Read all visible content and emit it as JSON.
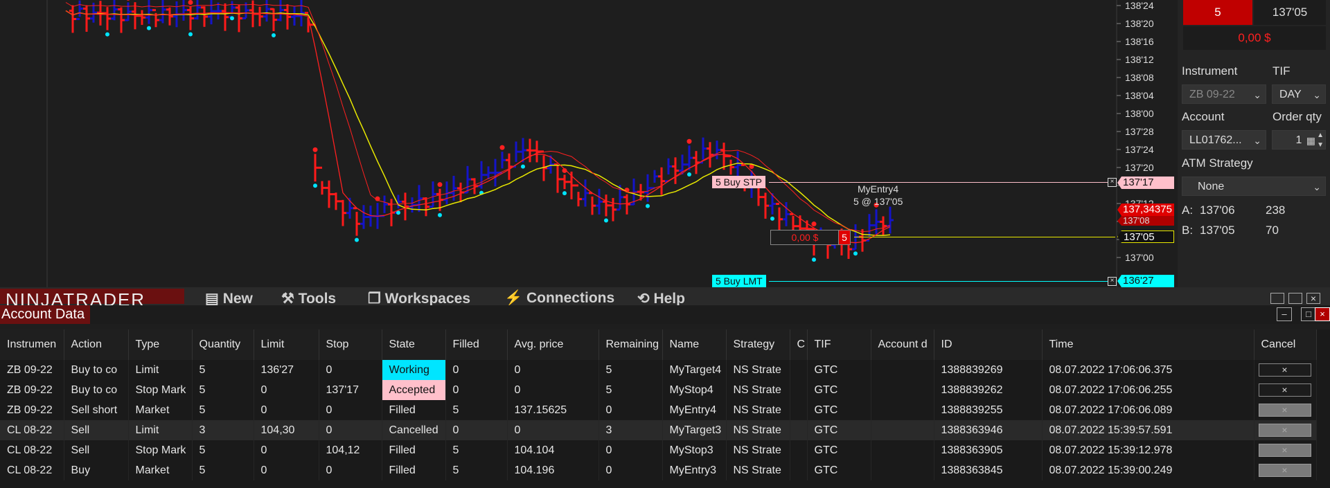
{
  "chart": {
    "price_axis": [
      "138'24",
      "138'20",
      "138'16",
      "138'12",
      "138'08",
      "138'04",
      "138'00",
      "137'28",
      "137'24",
      "137'20",
      "137'16",
      "137'12",
      "137'08",
      "137'04",
      "137'00"
    ],
    "last_price": "137,34375",
    "tags": {
      "buy_stp_price": "137'17",
      "last_price_dup": "137'08",
      "position_price": "137'05",
      "buy_lmt_price": "136'27"
    },
    "buy_stp_label": "5 Buy STP",
    "buy_lmt_label": "5 Buy LMT",
    "entry_name": "MyEntry4",
    "entry_detail": "5 @ 137'05",
    "pnl": "0,00 $",
    "position_qty": "5",
    "colors": {
      "up_bar": "#1414c8",
      "down_bar": "#ff1a1a",
      "sma_yellow": "#e8e800",
      "stop_tag": "#ffc0cb",
      "limit_tag": "#00ffff"
    }
  },
  "order_panel": {
    "qty": "5",
    "price": "137'05",
    "pnl": "0,00 $",
    "instrument_label": "Instrument",
    "tif_label": "TIF",
    "instrument_value": "ZB 09-22",
    "tif_value": "DAY",
    "account_label": "Account",
    "order_qty_label": "Order qty",
    "account_value": "LL01762...",
    "order_qty_value": "1",
    "atm_label": "ATM Strategy",
    "atm_value": "None",
    "ask_label": "A:",
    "ask_price": "137'06",
    "ask_size": "238",
    "bid_label": "B:",
    "bid_price": "137'05",
    "bid_size": "70"
  },
  "menubar": {
    "logo": "NINJATRADER",
    "items": [
      "New",
      "Tools",
      "Workspaces",
      "Connections",
      "Help"
    ]
  },
  "account_data": {
    "title": "Account Data",
    "columns": [
      "Instrumen",
      "Action",
      "Type",
      "Quantity",
      "Limit",
      "Stop",
      "State",
      "Filled",
      "Avg. price",
      "Remaining",
      "Name",
      "Strategy",
      "C",
      "TIF",
      "Account d",
      "ID",
      "Time",
      "Cancel"
    ],
    "rows": [
      [
        "ZB 09-22",
        "Buy to co",
        "Limit",
        "5",
        "136'27",
        "0",
        "Working",
        "0",
        "0",
        "5",
        "MyTarget4",
        "NS Strate",
        "",
        "GTC",
        "",
        "1388839269",
        "08.07.2022 17:06:06.375",
        "×"
      ],
      [
        "ZB 09-22",
        "Buy to co",
        "Stop Mark",
        "5",
        "0",
        "137'17",
        "Accepted",
        "0",
        "0",
        "5",
        "MyStop4",
        "NS Strate",
        "",
        "GTC",
        "",
        "1388839262",
        "08.07.2022 17:06:06.255",
        "×"
      ],
      [
        "ZB 09-22",
        "Sell short",
        "Market",
        "5",
        "0",
        "0",
        "Filled",
        "5",
        "137.15625",
        "0",
        "MyEntry4",
        "NS Strate",
        "",
        "GTC",
        "",
        "1388839255",
        "08.07.2022 17:06:06.089",
        "×"
      ],
      [
        "CL 08-22",
        "Sell",
        "Limit",
        "3",
        "104,30",
        "0",
        "Cancelled",
        "0",
        "0",
        "3",
        "MyTarget3",
        "NS Strate",
        "",
        "GTC",
        "",
        "1388363946",
        "08.07.2022 15:39:57.591",
        "×"
      ],
      [
        "CL 08-22",
        "Sell",
        "Stop Mark",
        "5",
        "0",
        "104,12",
        "Filled",
        "5",
        "104.104",
        "0",
        "MyStop3",
        "NS Strate",
        "",
        "GTC",
        "",
        "1388363905",
        "08.07.2022 15:39:12.978",
        "×"
      ],
      [
        "CL 08-22",
        "Buy",
        "Market",
        "5",
        "0",
        "0",
        "Filled",
        "5",
        "104.196",
        "0",
        "MyEntry3",
        "NS Strate",
        "",
        "GTC",
        "",
        "1388363845",
        "08.07.2022 15:39:00.249",
        "×"
      ]
    ],
    "state_colors": {
      "Working": "#00e5ff",
      "Accepted": "#ffc0cb"
    }
  }
}
